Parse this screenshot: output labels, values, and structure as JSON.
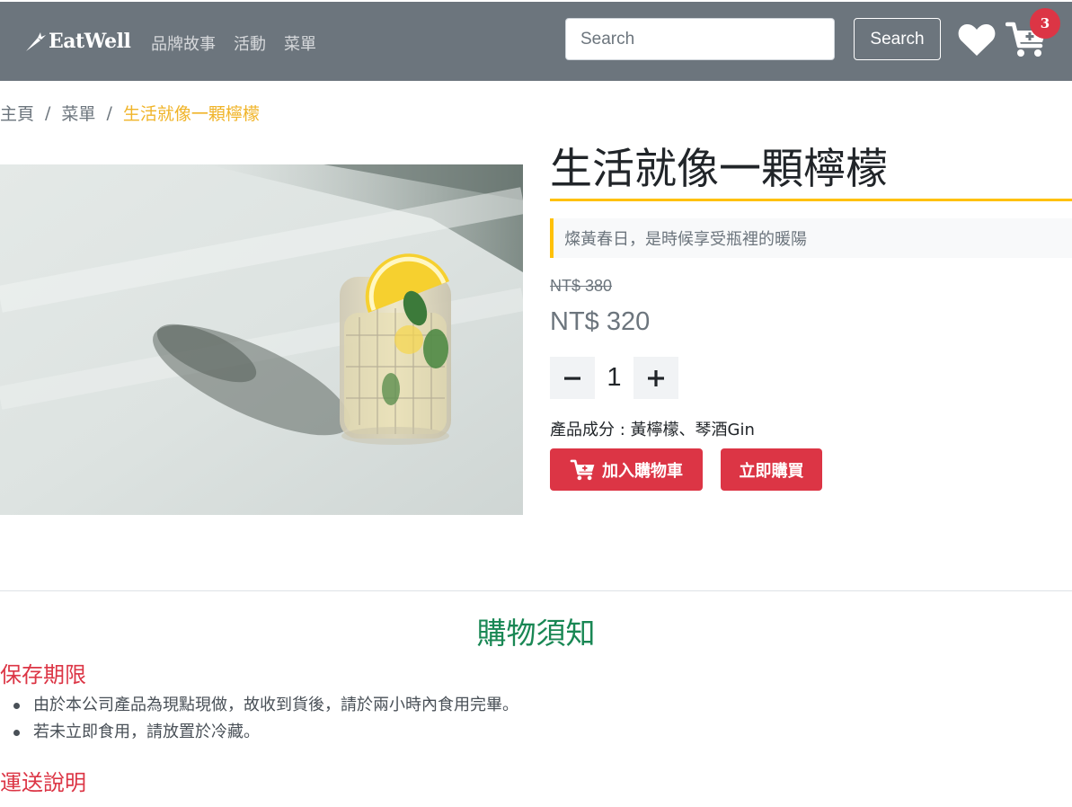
{
  "navbar": {
    "brand": "EatWell",
    "links": [
      "品牌故事",
      "活動",
      "菜單"
    ],
    "search_placeholder": "Search",
    "search_button": "Search",
    "cart_count": "3",
    "icons": [
      "carrot-icon",
      "heart-icon",
      "cart-plus-icon"
    ]
  },
  "breadcrumb": {
    "home": "主頁",
    "menu": "菜單",
    "current": "生活就像一顆檸檬",
    "separator": "/"
  },
  "product": {
    "title": "生活就像一顆檸檬",
    "subtitle": "燦黃春日，是時候享受瓶裡的暖陽",
    "original_price": "NT$ 380",
    "sale_price": "NT$ 320",
    "quantity": "1",
    "ingredients": "產品成分 : 黃檸檬、琴酒Gin",
    "add_to_cart": "加入購物車",
    "buy_now": "立即購買"
  },
  "notice": {
    "title": "購物須知",
    "sections": [
      {
        "heading": "保存期限",
        "items": [
          "由於本公司產品為現點現做，故收到貨後，請於兩小時內食用完畢。",
          "若未立即食用，請放置於冷藏。"
        ]
      },
      {
        "heading": "運送說明"
      }
    ]
  },
  "colors": {
    "navbar": "#6c757d",
    "accent_yellow": "#ffc107",
    "danger": "#dc3545",
    "success": "#198754"
  }
}
